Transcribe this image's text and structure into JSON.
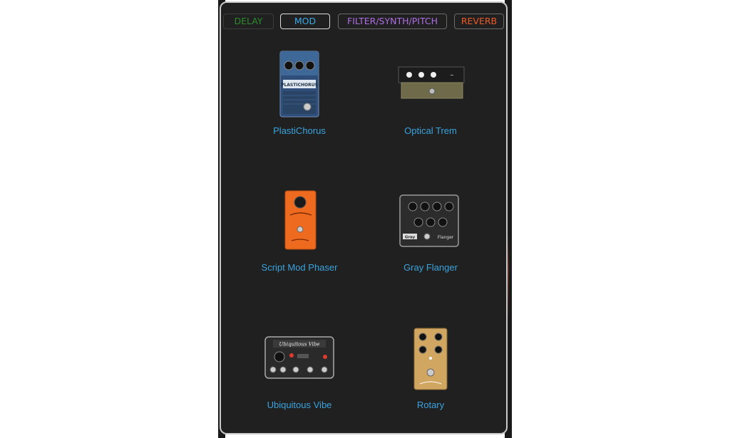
{
  "tabs": {
    "delay": "DELAY",
    "mod": "MOD",
    "filter": "FILTER/SYNTH/PITCH",
    "reverb": "REVERB",
    "selected": "MOD"
  },
  "pedals": [
    {
      "name": "PlastiChorus",
      "badge": "PLASTICHORUS"
    },
    {
      "name": "Optical Trem"
    },
    {
      "name": "Script Mod Phaser"
    },
    {
      "name": "Gray Flanger",
      "labels": [
        "Gray",
        "Flanger"
      ]
    },
    {
      "name": "Ubiquitous Vibe",
      "badge": "Ubiquitous Vibe"
    },
    {
      "name": "Rotary"
    }
  ],
  "colors": {
    "panel_bg": "#202020",
    "label": "#3aa3de",
    "delay": "#2e8b2e",
    "mod": "#3da9e8",
    "filter": "#b06ee6",
    "reverb": "#ee5a28"
  }
}
